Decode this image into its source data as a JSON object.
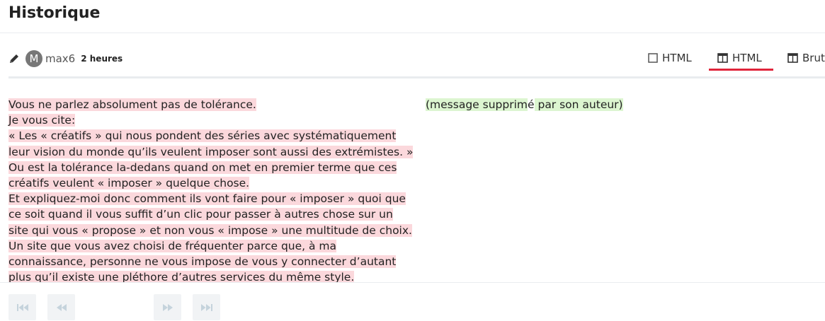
{
  "page": {
    "title": "Historique"
  },
  "revision": {
    "avatar_letter": "M",
    "username": "max6",
    "age": "2 heures"
  },
  "tabs": [
    {
      "label": "HTML",
      "icon": "square-icon",
      "active": false
    },
    {
      "label": "HTML",
      "icon": "side-by-side-icon",
      "active": true
    },
    {
      "label": "Brut",
      "icon": "side-by-side-icon",
      "active": false
    }
  ],
  "accent_color": "#e0253b",
  "diff": {
    "left_lines": [
      "Vous ne parlez absolument pas de tolérance.",
      "Je vous cite:",
      "« Les « créatifs » qui nous pondent des séries avec systématiquement leur vision du monde qu’ils veulent imposer sont aussi des extrémistes. »",
      "Ou est la tolérance la-dedans quand on met en premier terme que ces créatifs veulent « imposer » quelque chose.",
      "Et expliquez-moi donc comment ils vont faire pour « imposer » quoi que ce soit quand il vous suffit d’un clic pour passer à autres chose sur un site qui vous « propose » et non vous « impose » une multitude de choix.",
      "Un site que vous avez choisi de fréquenter parce que, à ma connaissance, personne ne vous impose de vous y connecter d’autant plus qu’il existe une pléthore d’autres services du même style."
    ],
    "right_parts": [
      {
        "text": "(message supprim",
        "ins": true
      },
      {
        "text": "é",
        "ins": false
      },
      {
        "text": " par son auteur)",
        "ins": true
      }
    ]
  },
  "nav": {
    "first": "first-icon",
    "prev": "previous-icon",
    "next": "next-icon",
    "last": "last-icon"
  }
}
